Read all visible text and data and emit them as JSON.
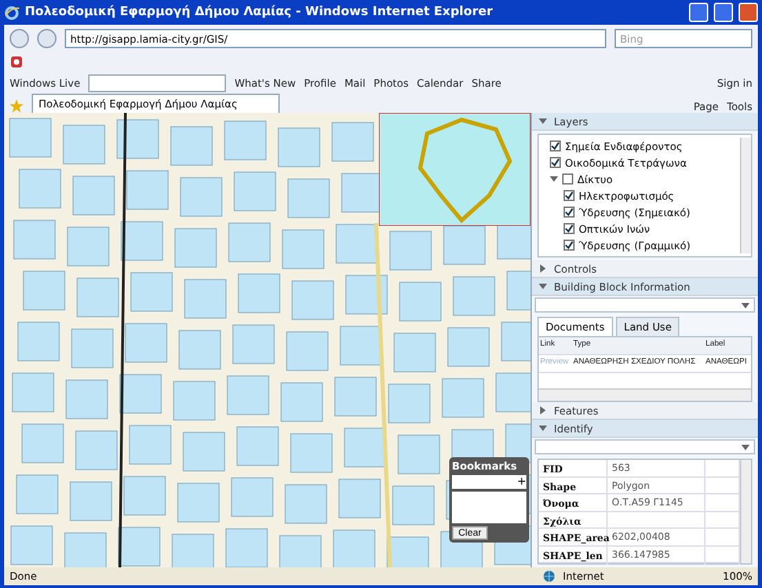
{
  "window": {
    "title": "Πολεοδομική Εφαρμογή Δήμου Λαμίας - Windows Internet Explorer"
  },
  "address_bar": {
    "url": "http://gisapp.lamia-city.gr/GIS/",
    "search_placeholder": "Bing"
  },
  "live_bar": {
    "brand": "Windows Live",
    "links": [
      "What's New",
      "Profile",
      "Mail",
      "Photos",
      "Calendar",
      "Share"
    ],
    "sign_in": "Sign in"
  },
  "tab": {
    "title": "Πολεοδομική Εφαρμογή Δήμου Λαμίας"
  },
  "command_bar": {
    "menus": [
      "Page",
      "Tools"
    ]
  },
  "bookmarks": {
    "title": "Bookmarks",
    "add": "+",
    "clear": "Clear"
  },
  "panel": {
    "layers": {
      "title": "Layers",
      "expanded": true,
      "items": [
        {
          "label": "Σημεία Ενδιαφέροντος",
          "checked": true
        },
        {
          "label": "Οικοδομικά Τετράγωνα",
          "checked": true
        },
        {
          "label": "Δίκτυο",
          "checked": false,
          "expanded": true,
          "children": [
            {
              "label": "Ηλεκτροφωτισμός",
              "checked": true
            },
            {
              "label": "Ύδρευσης (Σημειακό)",
              "checked": true
            },
            {
              "label": "Οπτικών Ινών",
              "checked": true
            },
            {
              "label": "Ύδρευσης (Γραμμικό)",
              "checked": true
            }
          ]
        }
      ]
    },
    "controls": {
      "title": "Controls",
      "expanded": false
    },
    "building": {
      "title": "Building Block Information",
      "expanded": true,
      "tabs": [
        {
          "label": "Documents",
          "selected": true
        },
        {
          "label": "Land Use",
          "selected": false
        }
      ],
      "columns": [
        "Link",
        "Type",
        "Label"
      ],
      "rows": [
        [
          "Preview",
          "ΑΝΑΘΕΩΡΗΣΗ ΣΧΕΔΙΟΥ ΠΟΛΗΣ",
          "ΑΝΑΘΕΩΡΙ"
        ]
      ]
    },
    "features": {
      "title": "Features",
      "expanded": false
    },
    "identify": {
      "title": "Identify",
      "expanded": true,
      "rows": [
        {
          "field": "FID",
          "value": "563"
        },
        {
          "field": "Shape",
          "value": "Polygon"
        },
        {
          "field": "Όνομα",
          "value": "Ο.Τ.Α59 Γ1145"
        },
        {
          "field": "Σχόλια",
          "value": ""
        },
        {
          "field": "SHAPE_area",
          "value": "6202,00408"
        },
        {
          "field": "SHAPE_len",
          "value": "366.147985"
        }
      ]
    }
  },
  "status_bar": {
    "text": "Done",
    "zone": "Internet",
    "zoom": "100%"
  }
}
